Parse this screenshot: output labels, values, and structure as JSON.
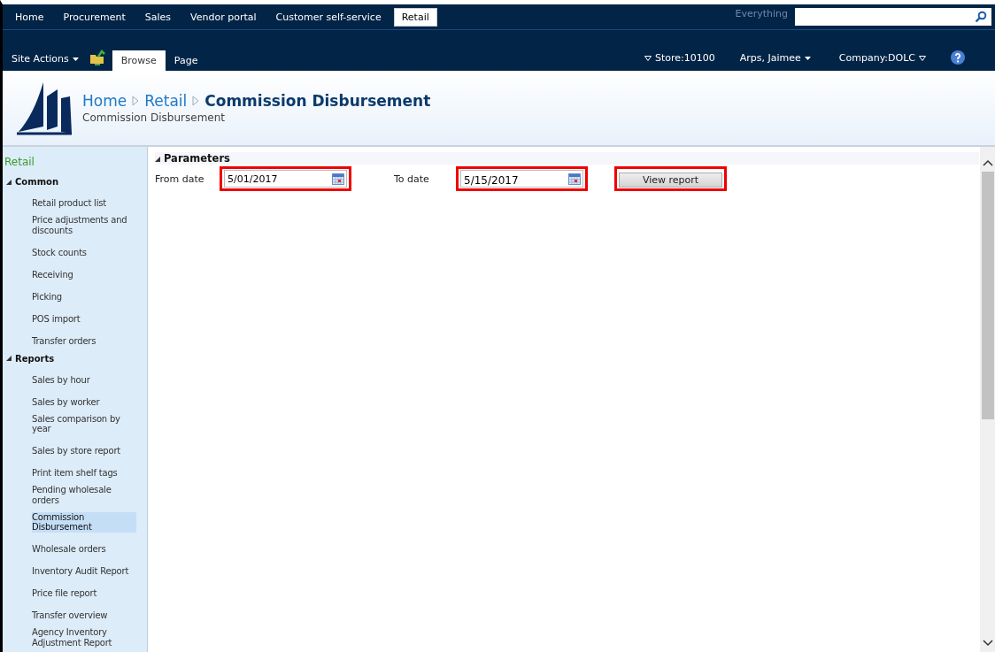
{
  "top_nav": [
    {
      "label": "Home",
      "selected": false
    },
    {
      "label": "Procurement",
      "selected": false
    },
    {
      "label": "Sales",
      "selected": false
    },
    {
      "label": "Vendor portal",
      "selected": false
    },
    {
      "label": "Customer self-service",
      "selected": false
    },
    {
      "label": "Retail",
      "selected": true
    }
  ],
  "search": {
    "scope": "Everything"
  },
  "ribbon": {
    "site_actions": "Site Actions",
    "tabs": [
      {
        "label": "Browse",
        "selected": true
      },
      {
        "label": "Page",
        "selected": false
      }
    ],
    "store": "Store:10100",
    "user": "Arps, Jaimee",
    "company": "Company:DOLC"
  },
  "header": {
    "breadcrumb": [
      "Home",
      "Retail",
      "Commission Disbursement"
    ],
    "subtitle": "Commission Disbursement"
  },
  "sidebar": {
    "title": "Retail",
    "groups": [
      {
        "label": "Common",
        "expanded": true,
        "items": [
          {
            "label": "Retail product list",
            "selected": false
          },
          {
            "label": "Price adjustments and discounts",
            "selected": false
          },
          {
            "label": "Stock counts",
            "selected": false
          },
          {
            "label": "Receiving",
            "selected": false
          },
          {
            "label": "Picking",
            "selected": false
          },
          {
            "label": "POS import",
            "selected": false
          },
          {
            "label": "Transfer orders",
            "selected": false
          }
        ]
      },
      {
        "label": "Reports",
        "expanded": true,
        "items": [
          {
            "label": "Sales by hour",
            "selected": false
          },
          {
            "label": "Sales by worker",
            "selected": false
          },
          {
            "label": "Sales comparison by year",
            "selected": false
          },
          {
            "label": "Sales by store report",
            "selected": false
          },
          {
            "label": "Print item shelf tags",
            "selected": false
          },
          {
            "label": "Pending wholesale orders",
            "selected": false
          },
          {
            "label": "Commission Disbursement",
            "selected": true
          },
          {
            "label": "Wholesale orders",
            "selected": false
          },
          {
            "label": "Inventory Audit Report",
            "selected": false
          },
          {
            "label": "Price file report",
            "selected": false
          },
          {
            "label": "Transfer overview",
            "selected": false
          },
          {
            "label": "Agency Inventory Adjustment Report",
            "selected": false
          }
        ]
      }
    ]
  },
  "parameters": {
    "title": "Parameters",
    "expanded": true,
    "from_label": "From date",
    "from_value": "5/01/2017",
    "to_label": "To date",
    "to_value": "5/15/2017",
    "button": "View report"
  }
}
